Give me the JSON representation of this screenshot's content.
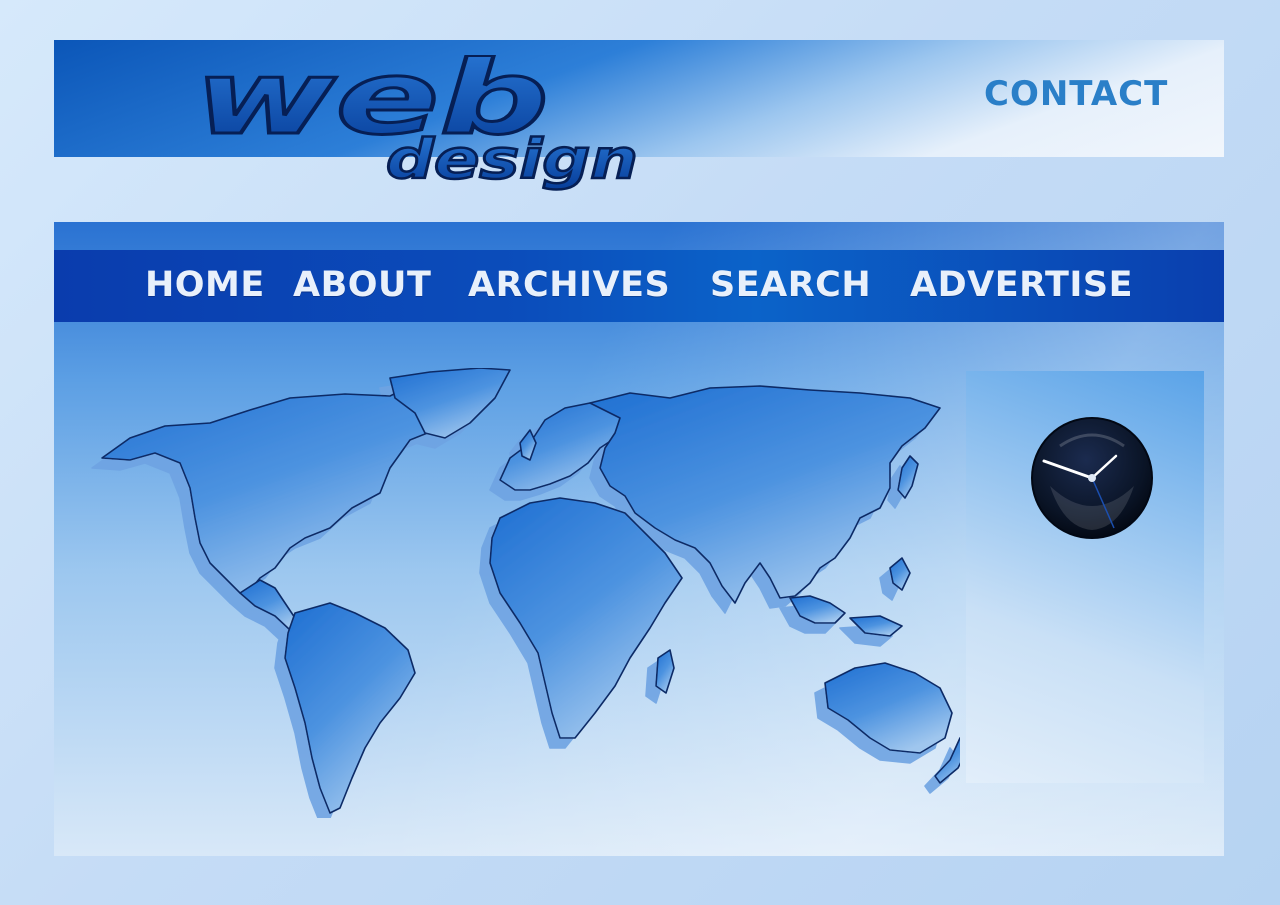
{
  "logo": {
    "line1": "web",
    "line2": "design"
  },
  "header": {
    "contact_label": "CONTACT"
  },
  "nav": {
    "items": [
      {
        "label": "HOME"
      },
      {
        "label": "ABOUT"
      },
      {
        "label": "ARCHIVES"
      },
      {
        "label": "SEARCH"
      },
      {
        "label": "ADVERTISE"
      }
    ]
  },
  "colors": {
    "accent": "#2a7fc8",
    "nav_bg": "#0b4dbb",
    "logo_fill": "#0b57b8"
  },
  "icons": {
    "map": "world-map-icon",
    "clock": "clock-icon"
  }
}
